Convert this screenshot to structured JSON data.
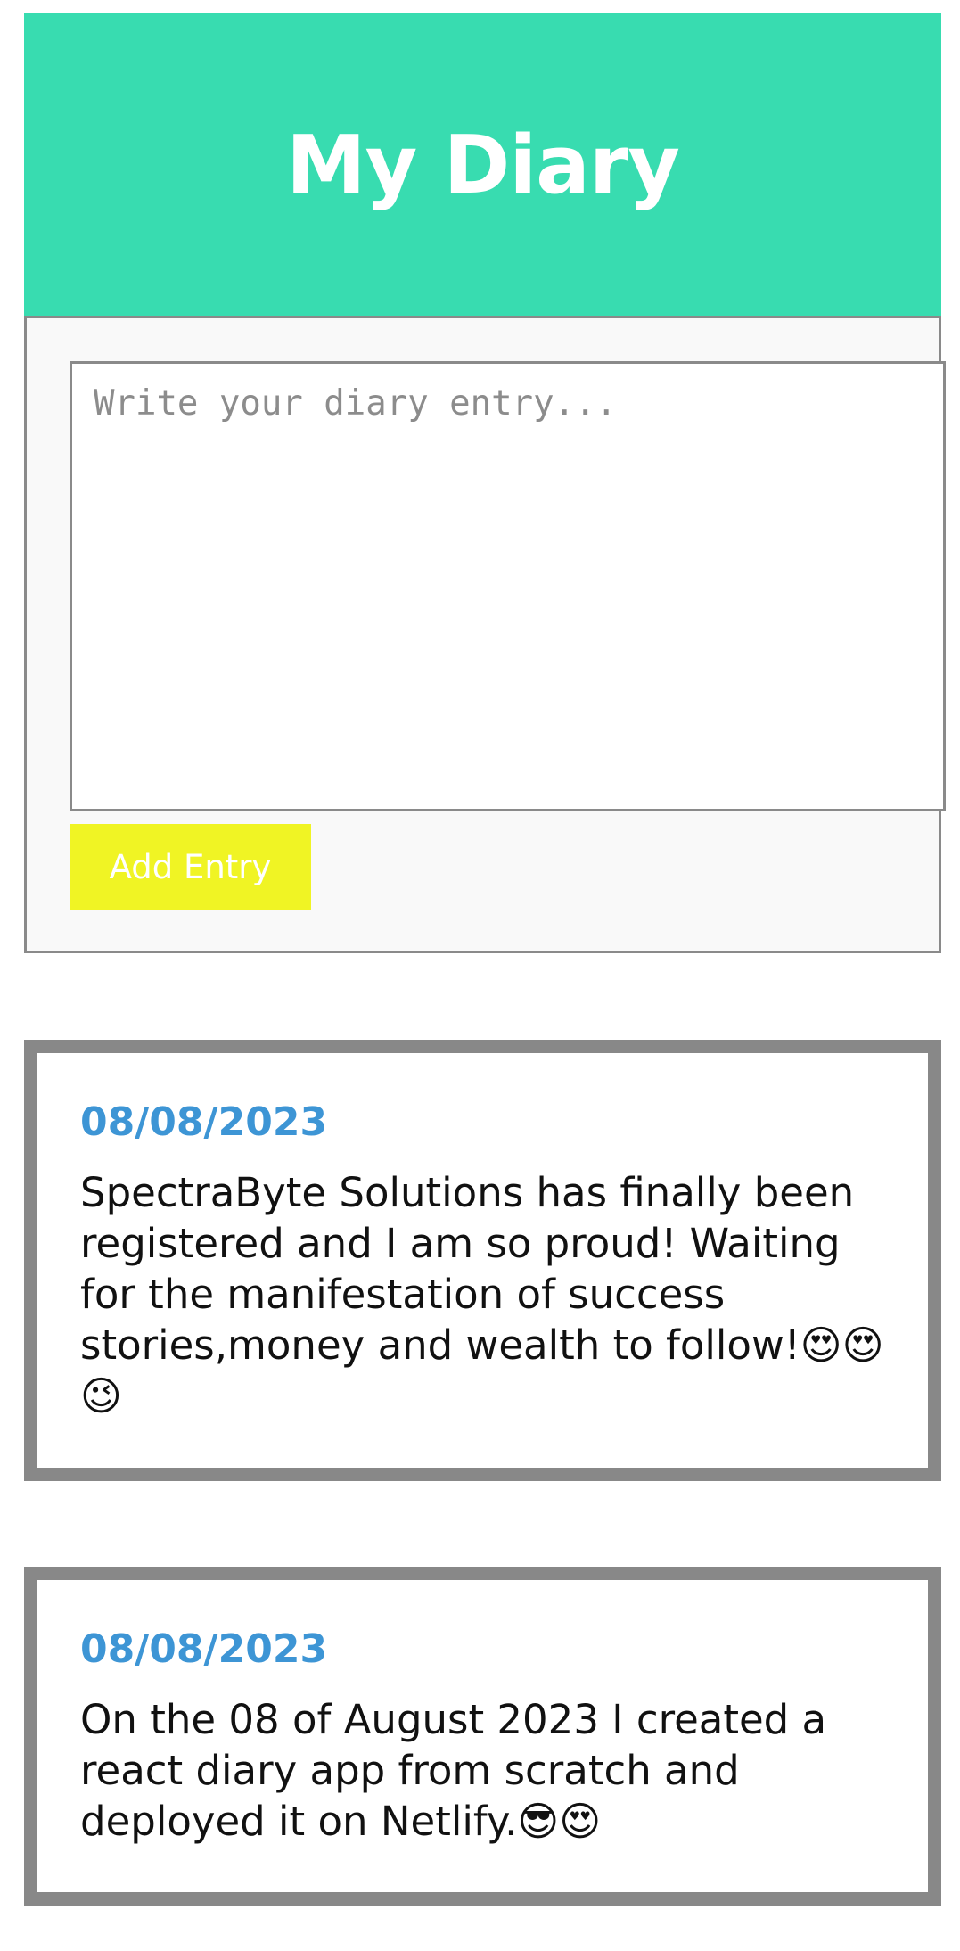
{
  "header": {
    "title": "My Diary",
    "background_color": "#38dcb0"
  },
  "form": {
    "textarea_placeholder": "Write your diary entry...",
    "textarea_value": "",
    "add_button_label": "Add Entry",
    "add_button_color": "#f0f424"
  },
  "entries": [
    {
      "date": "08/08/2023",
      "text": "SpectraByte Solutions has finally been registered and I am so proud! Waiting for the manifestation of success stories,money and wealth to follow!😍😍😉"
    },
    {
      "date": "08/08/2023",
      "text": "On the 08 of August 2023 I created a react diary app from scratch and deployed it on Netlify.😎😍"
    }
  ],
  "colors": {
    "date_color": "#3d95d5",
    "card_border": "#888888"
  }
}
